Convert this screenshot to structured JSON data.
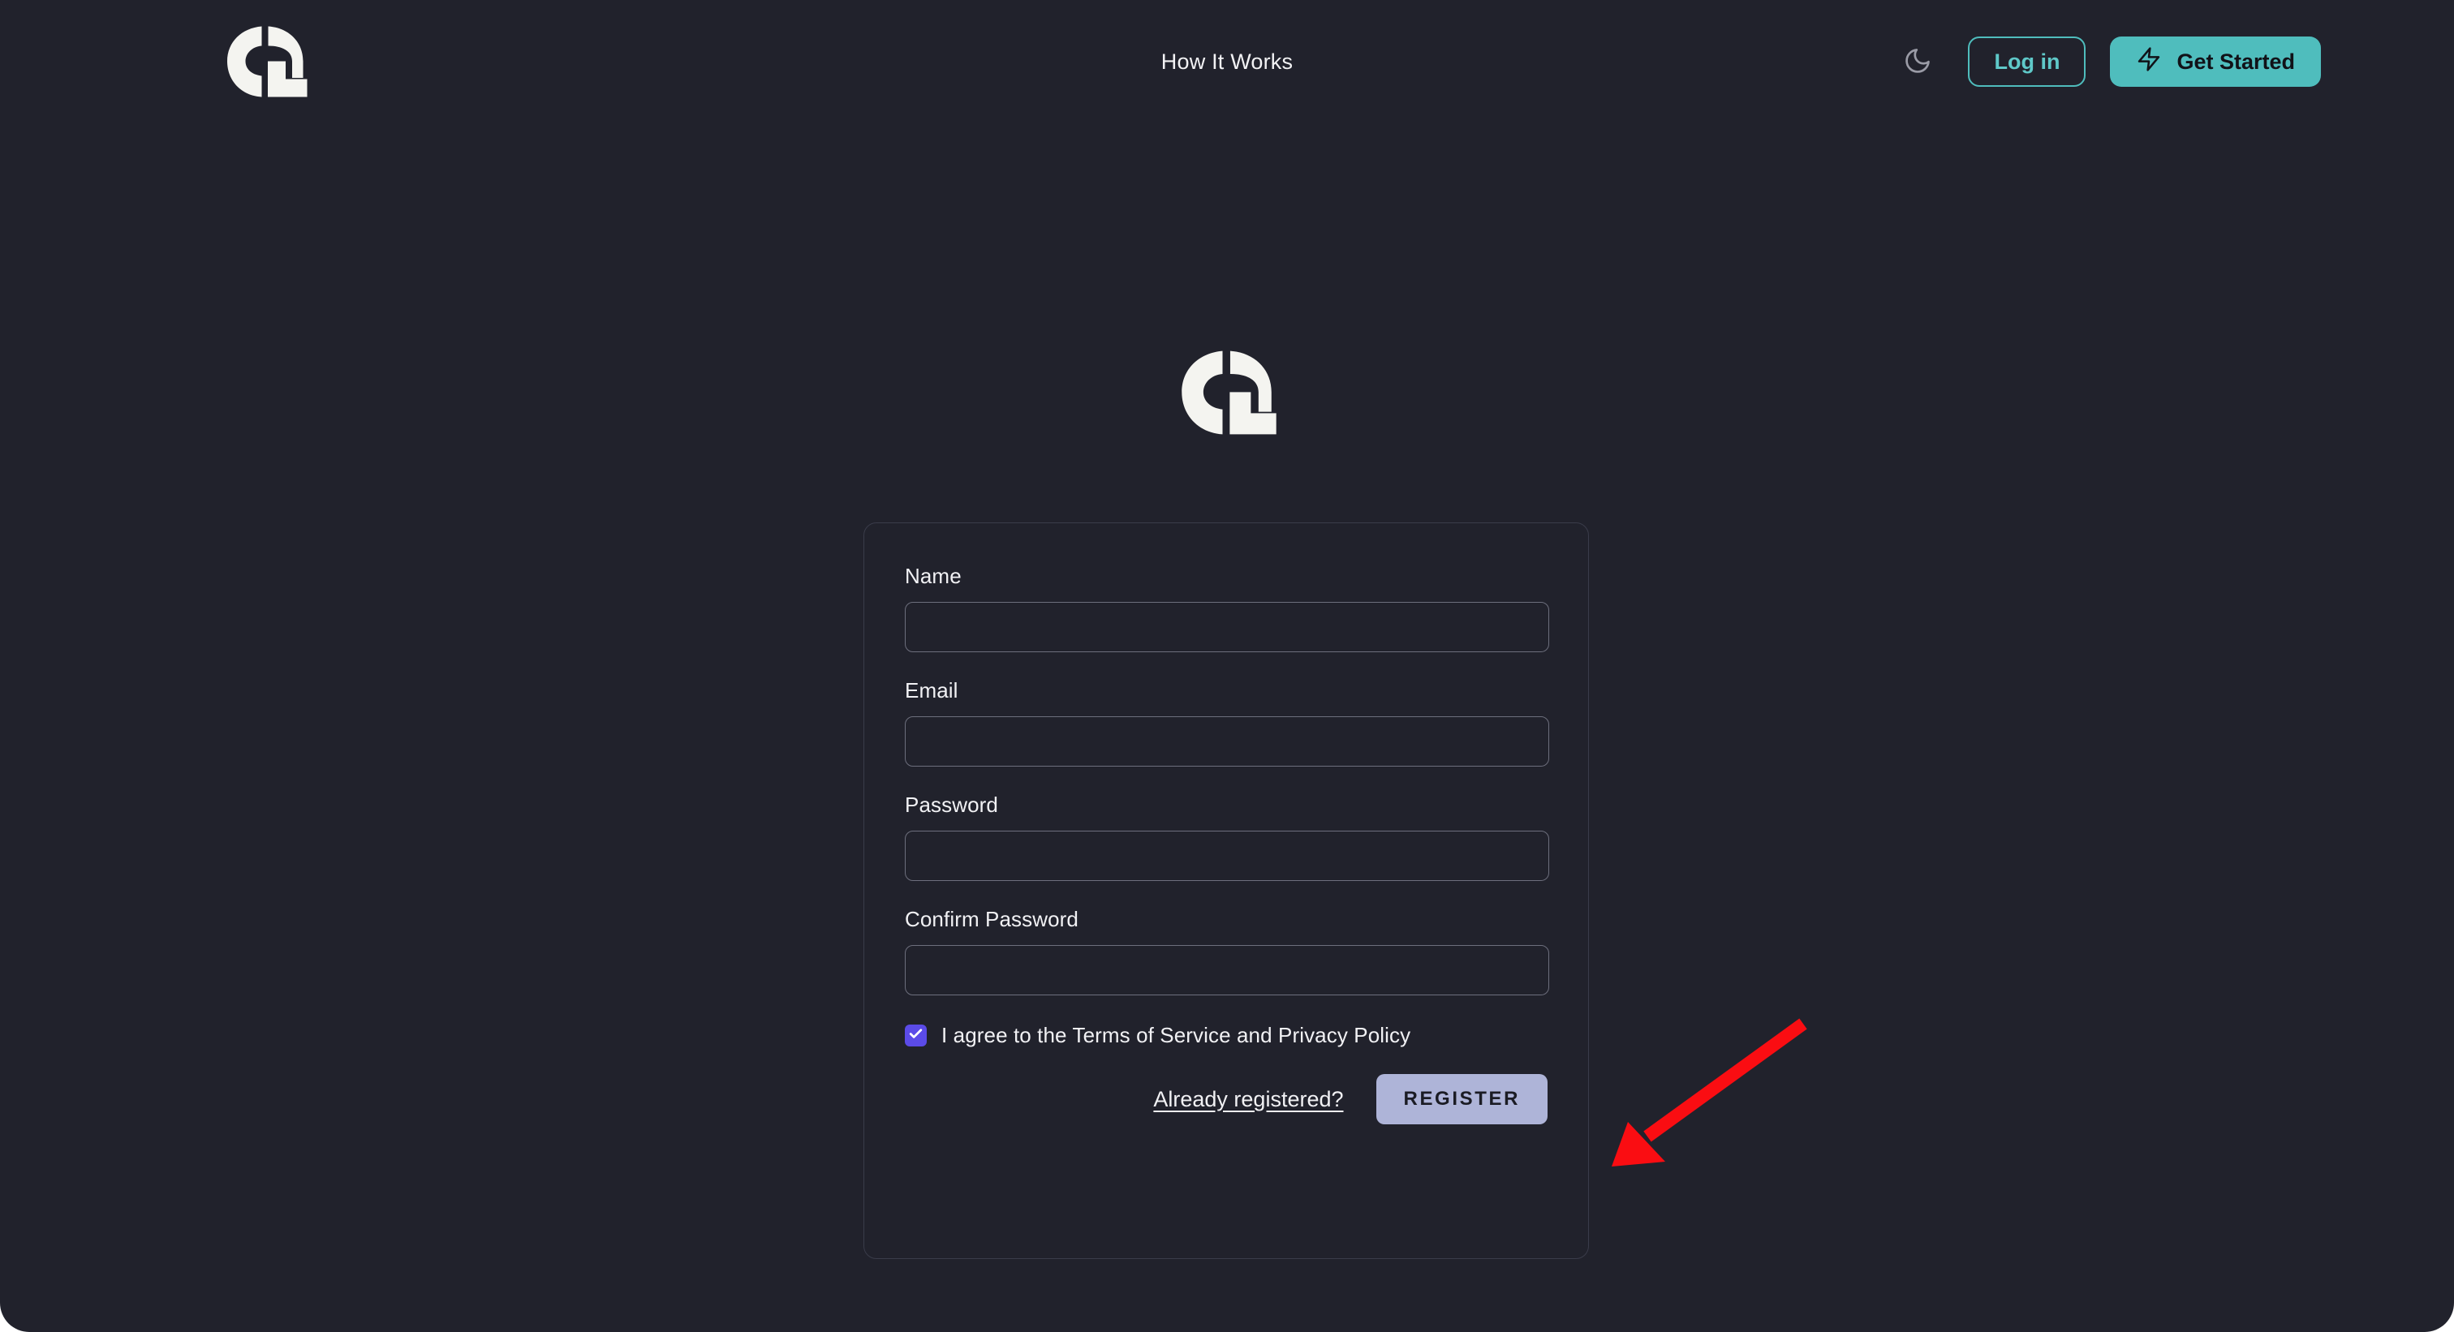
{
  "theme": {
    "page_background": "#21222c",
    "card_background": "#21222c",
    "accent_teal": "#4fbdbd",
    "checkbox_indigo": "#5b4be8",
    "register_button_bg": "#aeb4d8",
    "annotation_red": "#fa0d12",
    "text_primary": "#f1f1f4",
    "logo_color": "#f4f4f0",
    "border_muted": "#6d6f7d"
  },
  "header": {
    "logo_name": "brand-logo",
    "nav": [
      {
        "label": "How It Works"
      }
    ],
    "theme_toggle_icon": "moon-icon",
    "login_label": "Log in",
    "get_started_label": "Get Started",
    "get_started_icon": "lightning-bolt-icon"
  },
  "hero": {
    "logo_name": "brand-logo-large"
  },
  "form": {
    "fields": [
      {
        "label": "Name",
        "value": "",
        "placeholder": "",
        "type": "text",
        "name": "name-field"
      },
      {
        "label": "Email",
        "value": "",
        "placeholder": "",
        "type": "text",
        "name": "email-field"
      },
      {
        "label": "Password",
        "value": "",
        "placeholder": "",
        "type": "password",
        "name": "password-field"
      },
      {
        "label": "Confirm Password",
        "value": "",
        "placeholder": "",
        "type": "password",
        "name": "confirm-password-field"
      }
    ],
    "terms": {
      "checked": true,
      "check_glyph": "✓",
      "label": "I agree to the Terms of Service and Privacy Policy"
    },
    "already_registered_label": "Already registered?",
    "submit_label": "REGISTER"
  },
  "annotation": {
    "type": "arrow",
    "color": "#fa0d12",
    "points_to": "register-button"
  }
}
